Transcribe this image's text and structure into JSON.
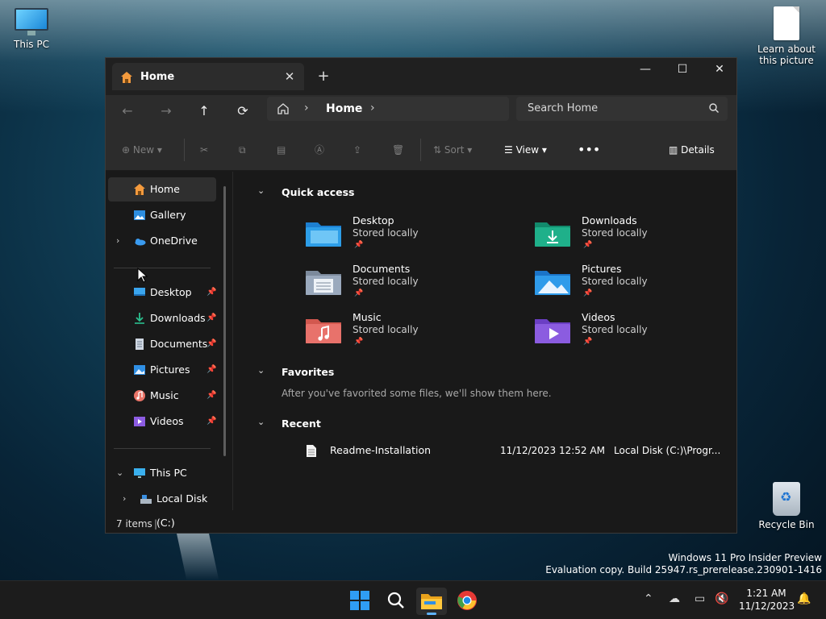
{
  "desktop": {
    "icons": [
      {
        "label": "This PC"
      },
      {
        "label": "Learn about this picture"
      },
      {
        "label": "Recycle Bin"
      }
    ],
    "watermark": {
      "line1": "Windows 11 Pro Insider Preview",
      "line2": "Evaluation copy. Build 25947.rs_prerelease.230901-1416"
    }
  },
  "window": {
    "tab": {
      "label": "Home",
      "icon": "home-icon"
    },
    "controls": {
      "minimize": "—",
      "maximize": "☐",
      "close": "✕"
    },
    "address": {
      "crumb": "Home"
    },
    "search": {
      "placeholder": "Search Home"
    },
    "toolbar": {
      "new": "New",
      "sort": "Sort",
      "view": "View",
      "details": "Details"
    },
    "sidebar": {
      "top": [
        {
          "label": "Home",
          "icon": "home-icon"
        },
        {
          "label": "Gallery",
          "icon": "gallery-icon"
        },
        {
          "label": "OneDrive",
          "icon": "cloud-icon"
        }
      ],
      "pinned": [
        {
          "label": "Desktop",
          "icon": "desktop-icon"
        },
        {
          "label": "Downloads",
          "icon": "download-icon"
        },
        {
          "label": "Documents",
          "icon": "document-icon"
        },
        {
          "label": "Pictures",
          "icon": "picture-icon"
        },
        {
          "label": "Music",
          "icon": "music-icon"
        },
        {
          "label": "Videos",
          "icon": "video-icon"
        }
      ],
      "this_pc": "This PC",
      "local_disk": "Local Disk (C:)"
    },
    "quick_access": {
      "title": "Quick access",
      "items": [
        {
          "name": "Desktop",
          "status": "Stored locally",
          "color": "#2d9ee8"
        },
        {
          "name": "Downloads",
          "status": "Stored locally",
          "color": "#1fb08a"
        },
        {
          "name": "Documents",
          "status": "Stored locally",
          "color": "#9aa9bd"
        },
        {
          "name": "Pictures",
          "status": "Stored locally",
          "color": "#2f9bea"
        },
        {
          "name": "Music",
          "status": "Stored locally",
          "color": "#e8726b"
        },
        {
          "name": "Videos",
          "status": "Stored locally",
          "color": "#8b5ce0"
        }
      ]
    },
    "favorites": {
      "title": "Favorites",
      "empty_text": "After you've favorited some files, we'll show them here."
    },
    "recent": {
      "title": "Recent",
      "items": [
        {
          "name": "Readme-Installation",
          "date": "11/12/2023 12:52 AM",
          "location": "Local Disk (C:)\\Progr..."
        }
      ]
    },
    "status": {
      "count": "7 items"
    }
  },
  "taskbar": {
    "time": "1:21 AM",
    "date": "11/12/2023"
  }
}
